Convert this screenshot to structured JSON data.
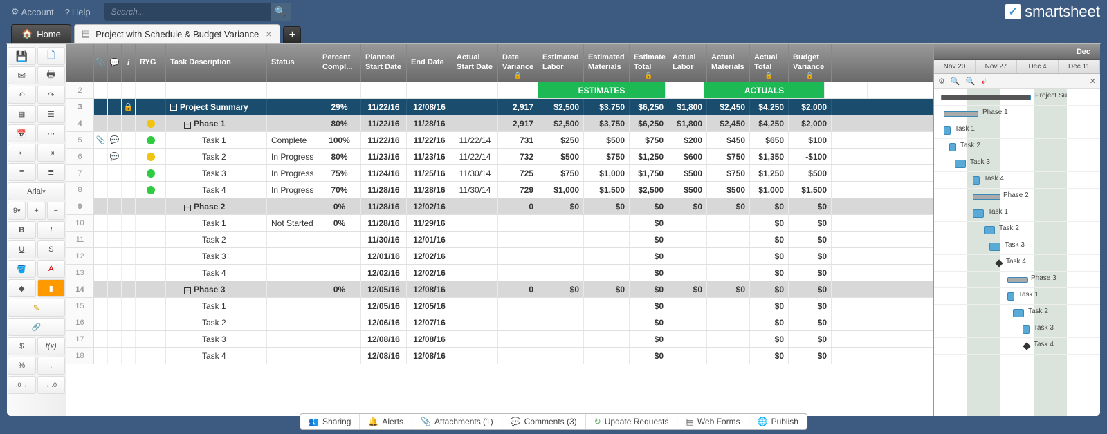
{
  "topbar": {
    "account": "Account",
    "help": "Help",
    "search_placeholder": "Search..."
  },
  "brand": "smartsheet",
  "tabs": {
    "home": "Home",
    "sheet": "Project with Schedule & Budget Variance"
  },
  "toolbar": {
    "font": "Arial",
    "size": "9",
    "bold": "B",
    "italic": "I",
    "underline": "U",
    "strike": "S",
    "currency": "$",
    "fx": "f(x)",
    "percent": "%",
    "comma": ","
  },
  "columns": [
    "RYG",
    "Task Description",
    "Status",
    "Percent Compl...",
    "Planned Start Date",
    "End Date",
    "Actual Start Date",
    "Date Variance",
    "Estimated Labor",
    "Estimated Materials",
    "Estimate Total",
    "Actual Labor",
    "Actual Materials",
    "Actual Total",
    "Budget Variance"
  ],
  "section_labels": {
    "estimates": "ESTIMATES",
    "actuals": "ACTUALS"
  },
  "rows": [
    {
      "n": 2,
      "type": "sections"
    },
    {
      "n": 3,
      "type": "summary",
      "lock": true,
      "desc": "Project Summary",
      "status": "",
      "pct": "29%",
      "pstart": "11/22/16",
      "end": "12/08/16",
      "astart": "",
      "dvar": "2,917",
      "elab": "$2,500",
      "emat": "$3,750",
      "etot": "$6,250",
      "alab": "$1,800",
      "amat": "$2,450",
      "atot": "$4,250",
      "bvar": "$2,000"
    },
    {
      "n": 4,
      "type": "phase",
      "ryg": "yellow",
      "desc": "Phase 1",
      "status": "",
      "pct": "80%",
      "pstart": "11/22/16",
      "end": "11/28/16",
      "astart": "",
      "dvar": "2,917",
      "elab": "$2,500",
      "emat": "$3,750",
      "etot": "$6,250",
      "alab": "$1,800",
      "amat": "$2,450",
      "atot": "$4,250",
      "bvar": "$2,000"
    },
    {
      "n": 5,
      "type": "task",
      "clip": true,
      "comment": true,
      "ryg": "green",
      "desc": "Task 1",
      "status": "Complete",
      "pct": "100%",
      "pstart": "11/22/16",
      "end": "11/22/16",
      "astart": "11/22/14",
      "dvar": "731",
      "elab": "$250",
      "emat": "$500",
      "etot": "$750",
      "alab": "$200",
      "amat": "$450",
      "atot": "$650",
      "bvar": "$100"
    },
    {
      "n": 6,
      "type": "task",
      "comment": true,
      "ryg": "yellow",
      "desc": "Task 2",
      "status": "In Progress",
      "pct": "80%",
      "pstart": "11/23/16",
      "end": "11/23/16",
      "astart": "11/22/14",
      "dvar": "732",
      "elab": "$500",
      "emat": "$750",
      "etot": "$1,250",
      "alab": "$600",
      "amat": "$750",
      "atot": "$1,350",
      "bvar": "-$100"
    },
    {
      "n": 7,
      "type": "task",
      "ryg": "green",
      "desc": "Task 3",
      "status": "In Progress",
      "pct": "75%",
      "pstart": "11/24/16",
      "end": "11/25/16",
      "astart": "11/30/14",
      "dvar": "725",
      "elab": "$750",
      "emat": "$1,000",
      "etot": "$1,750",
      "alab": "$500",
      "amat": "$750",
      "atot": "$1,250",
      "bvar": "$500"
    },
    {
      "n": 8,
      "type": "task",
      "ryg": "green",
      "desc": "Task 4",
      "status": "In Progress",
      "pct": "70%",
      "pstart": "11/28/16",
      "end": "11/28/16",
      "astart": "11/30/14",
      "dvar": "729",
      "elab": "$1,000",
      "emat": "$1,500",
      "etot": "$2,500",
      "alab": "$500",
      "amat": "$500",
      "atot": "$1,000",
      "bvar": "$1,500"
    },
    {
      "n": 9,
      "type": "phase",
      "desc": "Phase 2",
      "status": "",
      "pct": "0%",
      "pstart": "11/28/16",
      "end": "12/02/16",
      "astart": "",
      "dvar": "0",
      "elab": "$0",
      "emat": "$0",
      "etot": "$0",
      "alab": "$0",
      "amat": "$0",
      "atot": "$0",
      "bvar": "$0"
    },
    {
      "n": 10,
      "type": "task",
      "desc": "Task 1",
      "status": "Not Started",
      "pct": "0%",
      "pstart": "11/28/16",
      "end": "11/29/16",
      "astart": "",
      "dvar": "",
      "elab": "",
      "emat": "",
      "etot": "$0",
      "alab": "",
      "amat": "",
      "atot": "$0",
      "bvar": "$0"
    },
    {
      "n": 11,
      "type": "task",
      "desc": "Task 2",
      "status": "",
      "pct": "",
      "pstart": "11/30/16",
      "end": "12/01/16",
      "astart": "",
      "dvar": "",
      "elab": "",
      "emat": "",
      "etot": "$0",
      "alab": "",
      "amat": "",
      "atot": "$0",
      "bvar": "$0"
    },
    {
      "n": 12,
      "type": "task",
      "desc": "Task 3",
      "status": "",
      "pct": "",
      "pstart": "12/01/16",
      "end": "12/02/16",
      "astart": "",
      "dvar": "",
      "elab": "",
      "emat": "",
      "etot": "$0",
      "alab": "",
      "amat": "",
      "atot": "$0",
      "bvar": "$0"
    },
    {
      "n": 13,
      "type": "task",
      "desc": "Task 4",
      "status": "",
      "pct": "",
      "pstart": "12/02/16",
      "end": "12/02/16",
      "astart": "",
      "dvar": "",
      "elab": "",
      "emat": "",
      "etot": "$0",
      "alab": "",
      "amat": "",
      "atot": "$0",
      "bvar": "$0"
    },
    {
      "n": 14,
      "type": "phase",
      "desc": "Phase 3",
      "status": "",
      "pct": "0%",
      "pstart": "12/05/16",
      "end": "12/08/16",
      "astart": "",
      "dvar": "0",
      "elab": "$0",
      "emat": "$0",
      "etot": "$0",
      "alab": "$0",
      "amat": "$0",
      "atot": "$0",
      "bvar": "$0"
    },
    {
      "n": 15,
      "type": "task",
      "desc": "Task 1",
      "status": "",
      "pct": "",
      "pstart": "12/05/16",
      "end": "12/05/16",
      "astart": "",
      "dvar": "",
      "elab": "",
      "emat": "",
      "etot": "$0",
      "alab": "",
      "amat": "",
      "atot": "$0",
      "bvar": "$0"
    },
    {
      "n": 16,
      "type": "task",
      "desc": "Task 2",
      "status": "",
      "pct": "",
      "pstart": "12/06/16",
      "end": "12/07/16",
      "astart": "",
      "dvar": "",
      "elab": "",
      "emat": "",
      "etot": "$0",
      "alab": "",
      "amat": "",
      "atot": "$0",
      "bvar": "$0"
    },
    {
      "n": 17,
      "type": "task",
      "desc": "Task 3",
      "status": "",
      "pct": "",
      "pstart": "12/08/16",
      "end": "12/08/16",
      "astart": "",
      "dvar": "",
      "elab": "",
      "emat": "",
      "etot": "$0",
      "alab": "",
      "amat": "",
      "atot": "$0",
      "bvar": "$0"
    },
    {
      "n": 18,
      "type": "task",
      "desc": "Task 4",
      "status": "",
      "pct": "",
      "pstart": "12/08/16",
      "end": "12/08/16",
      "astart": "",
      "dvar": "",
      "elab": "",
      "emat": "",
      "etot": "$0",
      "alab": "",
      "amat": "",
      "atot": "$0",
      "bvar": "$0"
    }
  ],
  "gantt": {
    "month": "Dec",
    "weeks": [
      "Nov 20",
      "Nov 27",
      "Dec 4",
      "Dec 11"
    ],
    "labels": {
      "summary": "Project Su...",
      "phase1": "Phase 1",
      "phase2": "Phase 2",
      "phase3": "Phase 3",
      "t1": "Task 1",
      "t2": "Task 2",
      "t3": "Task 3",
      "t4": "Task 4"
    }
  },
  "bottom": {
    "sharing": "Sharing",
    "alerts": "Alerts",
    "attachments": "Attachments (1)",
    "comments": "Comments (3)",
    "update": "Update Requests",
    "webforms": "Web Forms",
    "publish": "Publish"
  }
}
